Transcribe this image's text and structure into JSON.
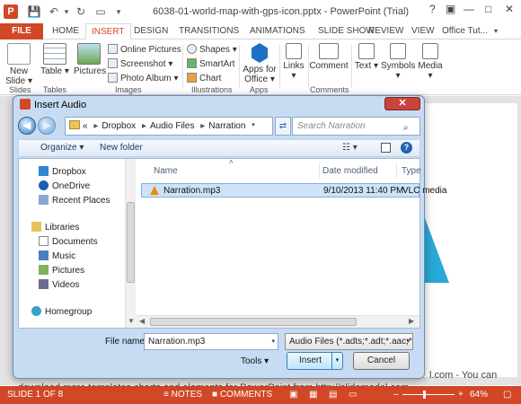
{
  "app": {
    "title": "6038-01-world-map-with-gps-icon.pptx - PowerPoint (Trial)",
    "ppt_logo": "P",
    "qat": {
      "save": "💾",
      "undo": "↶",
      "undo_dd": "▾",
      "redo": "↻",
      "customize": "▾"
    },
    "window": {
      "help": "?",
      "ribbon_opts": "▣",
      "minimize": "—",
      "maximize": "□",
      "close": "✕"
    },
    "account": "Office Tut...",
    "account_dd": "▾"
  },
  "ribbon_tabs": [
    "FILE",
    "HOME",
    "INSERT",
    "DESIGN",
    "TRANSITIONS",
    "ANIMATIONS",
    "SLIDE SHOW",
    "REVIEW",
    "VIEW"
  ],
  "ribbon": {
    "new_slide": "New Slide ▾",
    "table": "Table ▾",
    "pictures": "Pictures",
    "online_pictures": "Online Pictures",
    "screenshot": "Screenshot ▾",
    "photo_album": "Photo Album ▾",
    "shapes": "Shapes ▾",
    "smartart": "SmartArt",
    "chart": "Chart",
    "apps_for_office": "Apps for Office ▾",
    "links": "Links ▾",
    "comment": "Comment",
    "text": "Text ▾",
    "symbols": "Symbols ▾",
    "media": "Media ▾",
    "groups": [
      "Slides",
      "Tables",
      "Images",
      "Illustrations",
      "Apps",
      "Comments"
    ]
  },
  "slide": {
    "text_line1": "l.com - You can",
    "text_line2": "download more templates charts and elements for PowerPoint from http://slidemodel.com"
  },
  "status": {
    "slide": "SLIDE 1 OF 8",
    "notes": "≡ NOTES",
    "comments": "■ COMMENTS",
    "zoom": "64%",
    "zoom_minus": "–",
    "zoom_plus": "+",
    "fit": "▢"
  },
  "dialog": {
    "title": "Insert Audio",
    "close": "✕",
    "back": "◀",
    "forward": "▶",
    "breadcrumb": {
      "overflow": "«",
      "parts": [
        "Dropbox",
        "Audio Files",
        "Narration"
      ],
      "sep": "▸"
    },
    "address_dd": "▾",
    "refresh": "⇄",
    "search_placeholder": "Search Narration",
    "search_icon": "⌕",
    "organize": "Organize ▾",
    "new_folder": "New folder",
    "views_icon": "☷ ▾",
    "help": "?",
    "nav_items": [
      "Dropbox",
      "OneDrive",
      "Recent Places",
      "Libraries",
      "Documents",
      "Music",
      "Pictures",
      "Videos",
      "Homegroup"
    ],
    "columns": [
      "Name",
      "Date modified",
      "Type"
    ],
    "sort_arrow": "˄",
    "files": [
      {
        "name": "Narration.mp3",
        "date": "9/10/2013 11:40 PM",
        "type": "VLC media"
      }
    ],
    "scroll_left": "◀",
    "scroll_right": "▶",
    "scroll_up": "▲",
    "scroll_down": "▼",
    "file_name_label": "File name:",
    "file_name_value": "Narration.mp3",
    "file_type_value": "Audio Files (*.adts;*.adt;*.aac;*.",
    "dropdown_arrow": "▾",
    "tools": "Tools ▾",
    "insert": "Insert",
    "cancel": "Cancel"
  },
  "colors": {
    "accent": "#d24726",
    "selection": "#cde3f8",
    "dialog_frame": "#c7dcf2"
  }
}
